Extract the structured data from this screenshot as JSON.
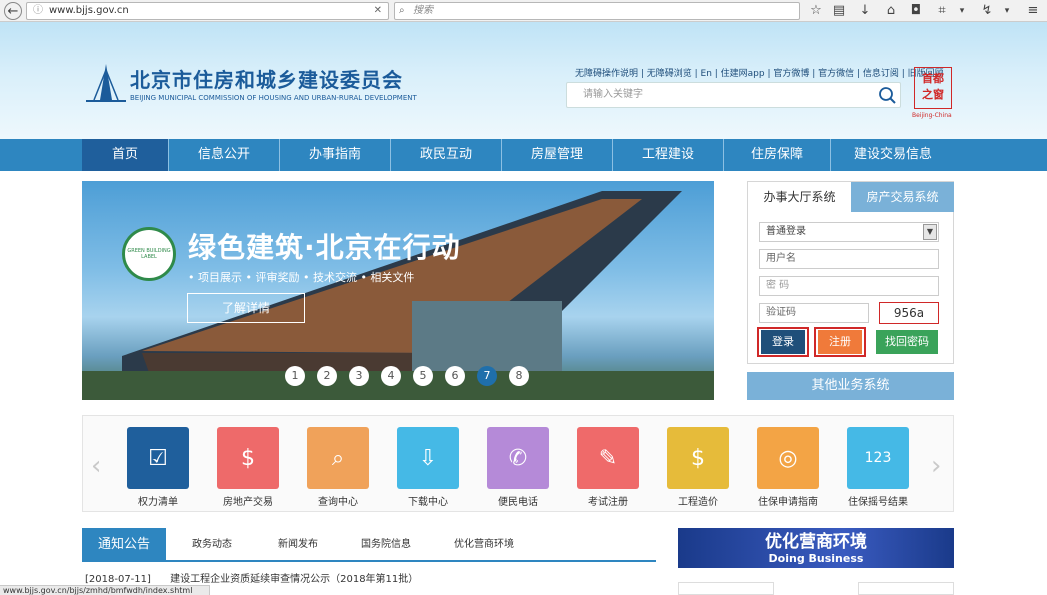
{
  "browser": {
    "url": "www.bjjs.gov.cn",
    "search_placeholder": "搜索",
    "status_url": "www.bjjs.gov.cn/bjjs/zmhd/bmfwdh/index.shtml"
  },
  "header": {
    "title_cn": "北京市住房和城乡建设委员会",
    "title_en": "BEIJING MUNICIPAL COMMISSION OF HOUSING AND URBAN-RURAL DEVELOPMENT",
    "top_links": "无障碍操作说明 | 无障碍浏览 | En | 住建网app | 官方微博 | 官方微信 | 信息订阅 | 旧版回顾",
    "search_placeholder": "请输入关键字",
    "seal_text": "首都之窗",
    "seal_sub": "Beijing-China"
  },
  "nav": {
    "items": [
      "首页",
      "信息公开",
      "办事指南",
      "政民互动",
      "房屋管理",
      "工程建设",
      "住房保障",
      "建设交易信息"
    ]
  },
  "banner": {
    "title": "绿色建筑·北京在行动",
    "subtitle": "• 项目展示  • 评审奖励  • 技术交流  • 相关文件",
    "button": "了解详情",
    "logo_text": "GREEN BUILDING LABEL",
    "dots": [
      "1",
      "2",
      "3",
      "4",
      "5",
      "6",
      "7",
      "8"
    ]
  },
  "login": {
    "tab_active": "办事大厅系统",
    "tab_other": "房产交易系统",
    "select_value": "普通登录",
    "username_placeholder": "用户名",
    "password_placeholder": "密  码",
    "captcha_placeholder": "验证码",
    "captcha_value": "956a",
    "login_btn": "登录",
    "register_btn": "注册",
    "forgot_btn": "找回密码",
    "other_systems": "其他业务系统"
  },
  "quick": {
    "items": [
      {
        "label": "权力清单",
        "color": "#1f5f9c"
      },
      {
        "label": "房地产交易",
        "color": "#ee6a6a"
      },
      {
        "label": "查询中心",
        "color": "#f0a25a"
      },
      {
        "label": "下载中心",
        "color": "#45b9e6"
      },
      {
        "label": "便民电话",
        "color": "#b58ad8"
      },
      {
        "label": "考试注册",
        "color": "#ef6a6a"
      },
      {
        "label": "工程造价",
        "color": "#e6bb3a"
      },
      {
        "label": "住保申请指南",
        "color": "#f3a445"
      },
      {
        "label": "住保摇号结果",
        "color": "#45b9e6"
      }
    ]
  },
  "news": {
    "active_tab": "通知公告",
    "tabs": [
      "政务动态",
      "新闻发布",
      "国务院信息",
      "优化营商环境"
    ],
    "item1_date": "[2018-07-11]",
    "item1_title": "建设工程企业资质延续审查情况公示（2018年第11批）"
  },
  "business": {
    "title_cn": "优化营商环境",
    "title_en": "Doing Business"
  }
}
